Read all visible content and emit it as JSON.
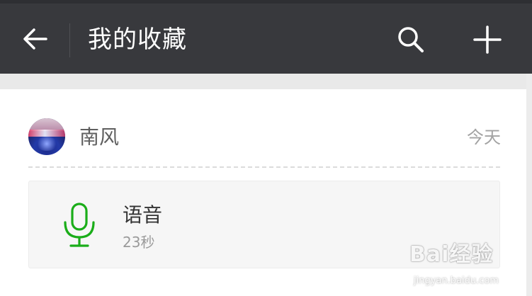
{
  "header": {
    "back_icon": "arrow-left-icon",
    "title": "我的收藏",
    "search_icon": "search-icon",
    "add_icon": "plus-icon"
  },
  "favorite_item": {
    "sender_name": "南风",
    "date": "今天",
    "content": {
      "type_icon": "microphone-icon",
      "title": "语音",
      "duration": "23秒"
    }
  },
  "watermark": {
    "main": "Bai经验",
    "sub": "jingyan.baidu.com"
  },
  "colors": {
    "topbar": "#38393d",
    "accent_green": "#1aad19",
    "background": "#f3f3f3"
  }
}
